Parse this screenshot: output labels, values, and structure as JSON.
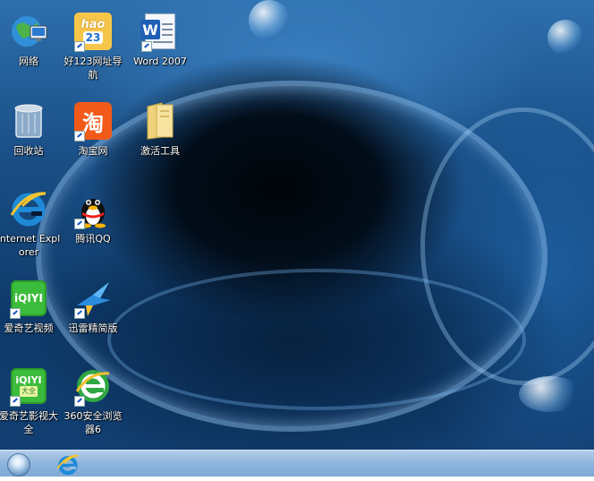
{
  "desktop": {
    "icons": [
      {
        "label": "网络",
        "icon": "network-icon"
      },
      {
        "label": "好123网址导航",
        "icon": "hao123-icon",
        "badge": "hao",
        "badge_number": "23"
      },
      {
        "label": "Word 2007",
        "icon": "word-icon",
        "badge": "W"
      },
      {
        "label": "回收站",
        "icon": "recycle-bin-icon"
      },
      {
        "label": "淘宝网",
        "icon": "taobao-icon",
        "badge": "淘"
      },
      {
        "label": "激活工具",
        "icon": "folder-icon"
      },
      {
        "label": "Internet Explorer",
        "icon": "internet-explorer-icon"
      },
      {
        "label": "腾讯QQ",
        "icon": "qq-penguin-icon"
      },
      {
        "label": "爱奇艺视频",
        "icon": "iqiyi-icon",
        "badge": "iQIYI"
      },
      {
        "label": "迅雷精简版",
        "icon": "xunlei-bird-icon"
      },
      {
        "label": "爱奇艺影视大全",
        "icon": "iqiyi-icon",
        "badge": "iQIYI",
        "badge_sub": "大全"
      },
      {
        "label": "360安全浏览器6",
        "icon": "360-browser-icon"
      }
    ]
  },
  "taskbar": {
    "start": "start-orb-icon",
    "pinned": [
      {
        "icon": "internet-explorer-icon"
      }
    ]
  },
  "colors": {
    "taskbar": "#9dbfe2",
    "label_text": "#ffffff",
    "ie_blue": "#1e8ad8",
    "taobao_orange": "#f25a19",
    "iqiyi_green": "#3cbc3c"
  }
}
